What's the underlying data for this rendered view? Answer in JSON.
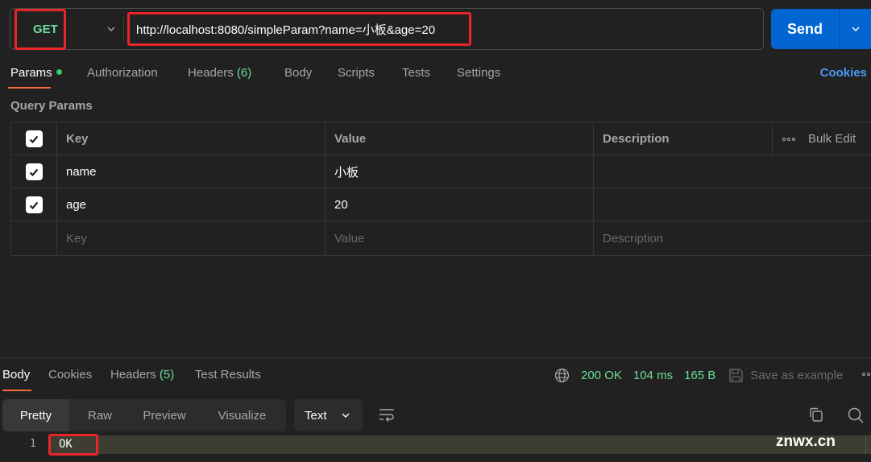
{
  "request": {
    "method": "GET",
    "url": "http://localhost:8080/simpleParam?name=小板&age=20",
    "send_label": "Send"
  },
  "request_tabs": [
    {
      "label": "Params",
      "active": true,
      "has_dot": true
    },
    {
      "label": "Authorization"
    },
    {
      "label": "Headers",
      "count": "(6)"
    },
    {
      "label": "Body"
    },
    {
      "label": "Scripts"
    },
    {
      "label": "Tests"
    },
    {
      "label": "Settings"
    }
  ],
  "cookies_link": "Cookies",
  "query_params": {
    "title": "Query Params",
    "headers": {
      "key": "Key",
      "value": "Value",
      "description": "Description",
      "bulk_edit": "Bulk Edit"
    },
    "rows": [
      {
        "checked": true,
        "key": "name",
        "value": "小板",
        "description": ""
      },
      {
        "checked": true,
        "key": "age",
        "value": "20",
        "description": ""
      }
    ],
    "placeholders": {
      "key": "Key",
      "value": "Value",
      "description": "Description"
    }
  },
  "response": {
    "tabs": [
      {
        "label": "Body",
        "active": true
      },
      {
        "label": "Cookies"
      },
      {
        "label": "Headers",
        "count": "(5)"
      },
      {
        "label": "Test Results"
      }
    ],
    "status": "200 OK",
    "time": "104 ms",
    "size": "165 B",
    "save_label": "Save as example",
    "view_modes": [
      "Pretty",
      "Raw",
      "Preview",
      "Visualize"
    ],
    "active_view": "Pretty",
    "format": "Text",
    "body_lines": [
      {
        "num": "1",
        "text": "OK"
      }
    ]
  },
  "colors": {
    "accent": "#0265d2",
    "method_green": "#6bdd9a",
    "tab_underline": "#f26b3a",
    "link_blue": "#4a9bf5",
    "highlight_red": "#e8262a"
  },
  "watermark": "znwx.cn"
}
